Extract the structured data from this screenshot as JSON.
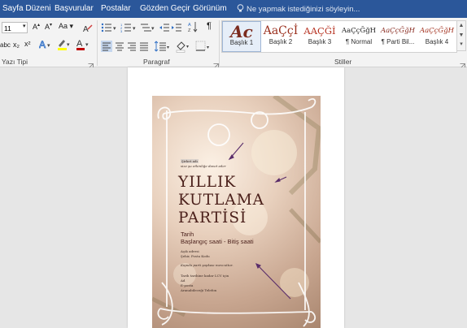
{
  "tabs": [
    "Sayfa Düzeni",
    "Başvurular",
    "Postalar",
    "Gözden Geçir",
    "Görünüm"
  ],
  "tell_me": "Ne yapmak istediğinizi söyleyin...",
  "font": {
    "size": "11"
  },
  "toolbar_text": {
    "aa": "Aa",
    "superscript_x": "x²",
    "subscript_x": "x₂",
    "abc": "abc"
  },
  "groups": {
    "font": "Yazı Tipi",
    "paragraph": "Paragraf",
    "styles": "Stiller"
  },
  "styles": [
    {
      "preview": "Ac",
      "name": "Başlık 1",
      "color": "#7b2b1e"
    },
    {
      "preview": "AaÇçİ",
      "name": "Başlık 2",
      "color": "#9a2f1d"
    },
    {
      "preview": "AAÇĞİ",
      "name": "Başlık 3",
      "color": "#b73322"
    },
    {
      "preview": "AaÇçĞğH",
      "name": "¶ Normal",
      "color": "#222222"
    },
    {
      "preview": "AaÇçĞğH",
      "name": "¶ Parti Bil...",
      "color": "#8a2d22"
    },
    {
      "preview": "AaÇçĞğH",
      "name": "Başlık 4",
      "color": "#a3321f"
    }
  ],
  "flyer": {
    "company": "Şirket adı",
    "tagline": "size şu etkinliğe davet eder",
    "title_lines": [
      "YILLIK",
      "KUTLAMA",
      "PARTİSİ"
    ],
    "date": "Tarih",
    "time": "Başlangıç saati - Bitiş saati",
    "address_lines": [
      "Açık adresi",
      "Şehir, Posta Kodu"
    ],
    "note": "Kapıda parti şapkası mevcuttur.",
    "rsvp_lines": [
      "Tarih tarihine kadar LCV için",
      "Ad",
      "E-posta",
      "Aranabileceği Telefon"
    ]
  }
}
